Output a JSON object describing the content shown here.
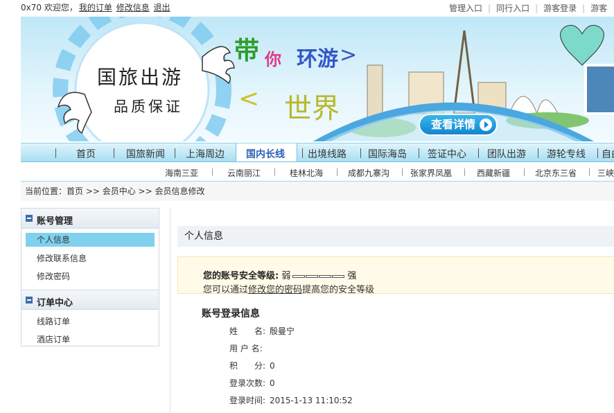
{
  "topbar": {
    "user": "0x70",
    "welcome": "欢迎您，",
    "my_orders": "我的订单",
    "edit_info": "修改信息",
    "logout": "退出",
    "right_links": [
      "管理入口",
      "同行入口",
      "游客登录",
      "游客"
    ]
  },
  "banner": {
    "slogan_line1": "国旅出游",
    "slogan_line2": "品质保证",
    "tagline_a": "带",
    "tagline_b": "你",
    "tagline_c": "环游",
    "tagline_d": ">",
    "tagline_e": "<",
    "tagline_f": "世界",
    "detail_button": "查看详情"
  },
  "nav": {
    "items": [
      "首页",
      "国旅新闻",
      "上海周边",
      "国内长线",
      "出境线路",
      "国际海岛",
      "签证中心",
      "团队出游",
      "游轮专线",
      "自由"
    ],
    "active": "国内长线"
  },
  "subnav": {
    "items": [
      "海南三亚",
      "云南丽江",
      "桂林北海",
      "成都九寨沟",
      "张家界凤凰",
      "西藏新疆",
      "北京东三省",
      "三峡"
    ]
  },
  "breadcrumb": "当前位置：首页 >> 会员中心 >> 会员信息修改",
  "sidebar": {
    "groups": [
      {
        "title": "账号管理",
        "items": [
          "个人信息",
          "修改联系信息",
          "修改密码"
        ]
      },
      {
        "title": "订单中心",
        "items": [
          "线路订单",
          "酒店订单"
        ]
      }
    ],
    "selected": "个人信息"
  },
  "content": {
    "section_title": "个人信息",
    "security_label": "您的账号安全等级:",
    "security_weak": "弱",
    "security_strong": "强",
    "security_tip_prefix": "您可以通过",
    "security_tip_link": "修改您的密码",
    "security_tip_suffix": "提高您的安全等级",
    "login_title": "账号登录信息",
    "fields": [
      {
        "label": "姓　　名:",
        "value": "殷曼宁"
      },
      {
        "label": "用 户 名:",
        "value": ""
      },
      {
        "label": "积　　分:",
        "value": "0"
      },
      {
        "label": "登录次数:",
        "value": "0"
      },
      {
        "label": "登录时间:",
        "value": "2015-1-13 11:10:52"
      }
    ]
  },
  "colors": {
    "nav_active_text": "#2a63b8",
    "sidebar_selected": "#7fd1ee",
    "security_bg": "#fffbe8",
    "detail_button": "#1286cf"
  }
}
